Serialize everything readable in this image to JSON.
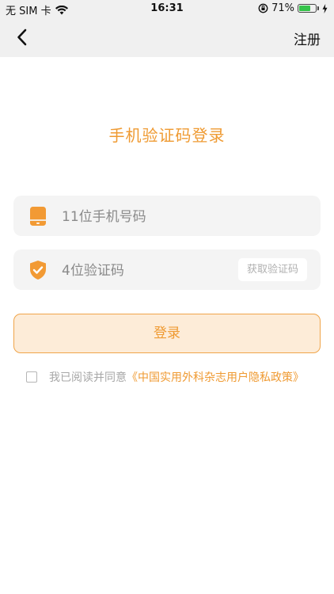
{
  "status_bar": {
    "carrier": "无 SIM 卡",
    "time": "16:31",
    "battery_percent_text": "71%",
    "battery_level": 0.71
  },
  "nav": {
    "register_label": "注册"
  },
  "title": "手机验证码登录",
  "phone_field": {
    "placeholder": "11位手机号码",
    "value": ""
  },
  "code_field": {
    "placeholder": "4位验证码",
    "value": "",
    "get_code_label": "获取验证码"
  },
  "login_label": "登录",
  "agreement": {
    "text": "我已阅读并同意",
    "policy_link": "《中国实用外科杂志用户隐私政策》",
    "checked": false
  },
  "colors": {
    "accent": "#ef9a32",
    "login_bg": "#fdecd8",
    "field_bg": "#f4f4f4"
  }
}
